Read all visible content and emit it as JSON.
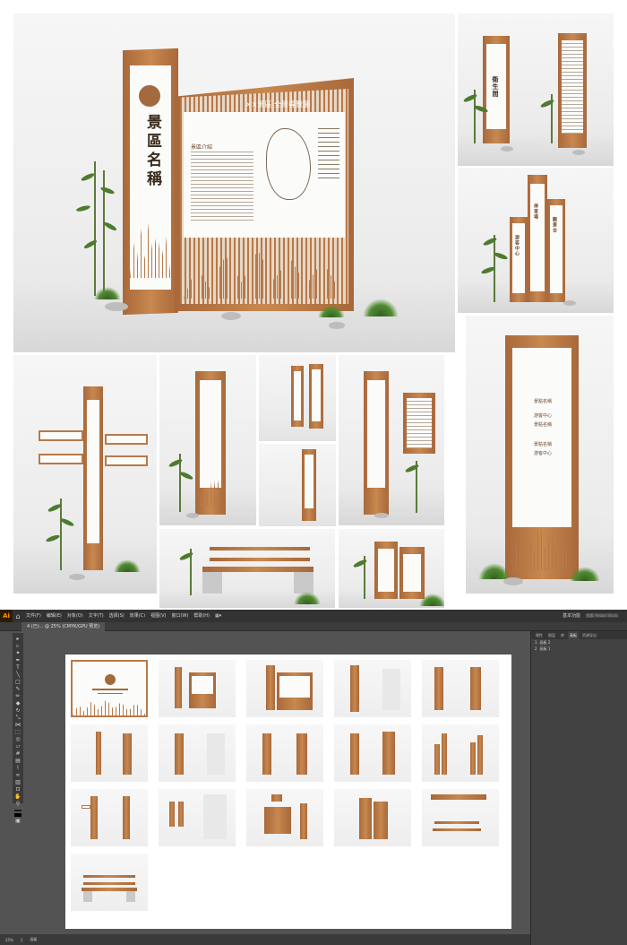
{
  "collage": {
    "main_sign_vertical_text": "景區名稱",
    "main_board_header": "××景區 全景導覽圖",
    "main_board_panel_title": "景區介紹",
    "portrait_sign_title": "衛生間",
    "cluster_sign_labels": [
      "游客中心",
      "停車場",
      "觀景台"
    ],
    "tall_sign_labels": [
      "景點名稱",
      "游客中心",
      "景點名稱",
      "景點名稱",
      "游客中心"
    ],
    "bench_note": "",
    "colors": {
      "wood": "#b7794a",
      "panel": "#fbfbfa",
      "bamboo": "#4e7a2e"
    }
  },
  "app": {
    "logo_text": "Ai",
    "home_icon": "home-icon",
    "menu": [
      "文件(F)",
      "编辑(E)",
      "对象(O)",
      "文字(T)",
      "选择(S)",
      "效果(C)",
      "视图(V)",
      "窗口(W)",
      "帮助(H)"
    ],
    "workspace_label": "基本功能",
    "search_placeholder": "搜索 Adobe Stock",
    "document_tab": "4 (已)... @ 25% (CMYK/GPU 预览)",
    "tools": [
      "selection-icon",
      "direct-select-icon",
      "magic-wand-icon",
      "lasso-icon",
      "pen-icon",
      "curvature-icon",
      "type-icon",
      "line-icon",
      "rectangle-icon",
      "paintbrush-icon",
      "pencil-icon",
      "eraser-icon",
      "rotate-icon",
      "scale-icon",
      "width-icon",
      "free-transform-icon",
      "shape-builder-icon",
      "perspective-icon",
      "mesh-icon",
      "gradient-icon",
      "eyedropper-icon",
      "blend-icon",
      "symbol-sprayer-icon",
      "graph-icon",
      "artboard-icon",
      "slice-icon",
      "hand-icon",
      "zoom-icon"
    ],
    "panel_tabs": [
      "属性",
      "图层",
      "库",
      "画板",
      "资源导出"
    ],
    "layers": [
      {
        "index": "1",
        "name": "画板 2"
      },
      {
        "index": "2",
        "name": "画板 1"
      }
    ],
    "status": {
      "zoom": "25%",
      "artboard_num": "1",
      "mode": "画板"
    }
  }
}
